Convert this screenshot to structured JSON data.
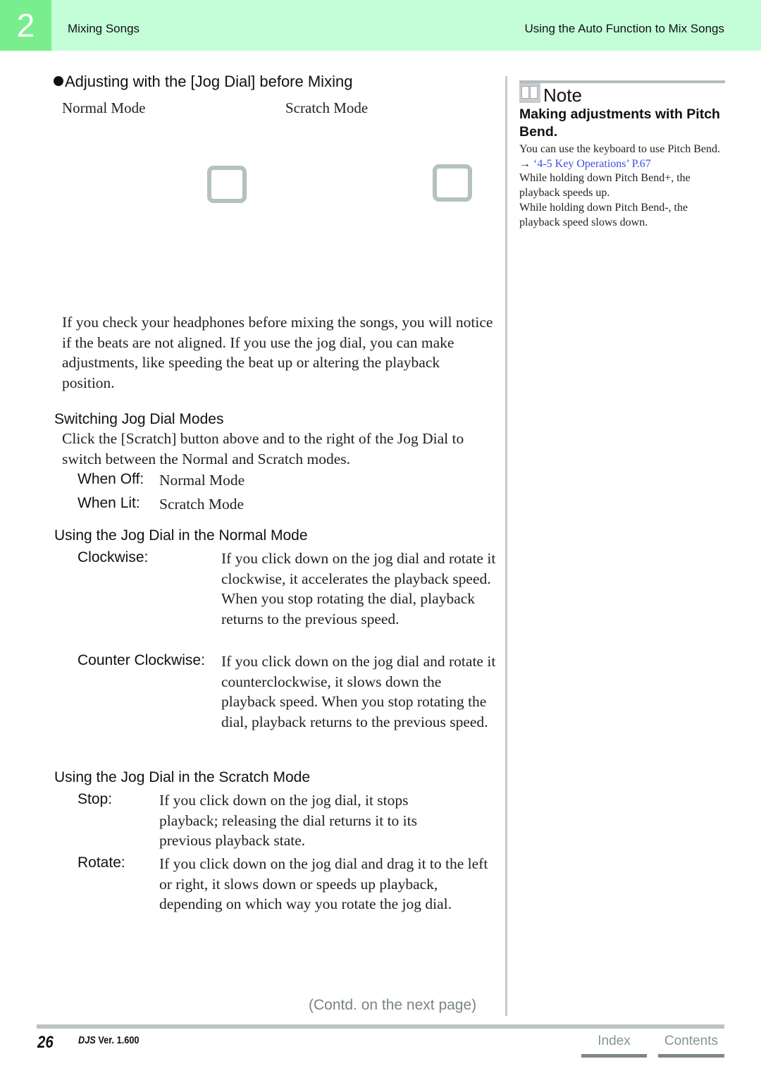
{
  "header": {
    "chapter_number": "2",
    "chapter_title": "Mixing Songs",
    "section_title": "Using the Auto Function to Mix Songs"
  },
  "main": {
    "section_heading": "Adjusting with the [Jog Dial] before Mixing",
    "bullet_icon": "filled-circle",
    "mode_labels": {
      "normal": "Normal Mode",
      "scratch": "Scratch Mode"
    },
    "intro_paragraph": "If you check your headphones before mixing the songs, you will notice if the beats are not aligned. If you use the jog dial, you can make adjustments, like speeding the beat up or altering the playback position.",
    "switching": {
      "heading": "Switching Jog Dial Modes",
      "paragraph": "Click the [Scratch] button above and to the right of the Jog Dial to switch between the Normal and Scratch modes.",
      "items": [
        {
          "term": "When Off:",
          "value": "Normal Mode"
        },
        {
          "term": "When Lit:",
          "value": "Scratch Mode"
        }
      ]
    },
    "normal_mode": {
      "heading": "Using the Jog Dial in the Normal Mode",
      "items": [
        {
          "term": "Clockwise:",
          "value": "If you click down on the jog dial and rotate it clockwise, it accelerates the playback speed. When you stop rotating the dial, playback returns to the previous speed."
        },
        {
          "term": "Counter Clockwise:",
          "value": "If you click down on the jog dial and rotate it counterclockwise, it slows down the playback speed. When you stop rotating the dial, playback returns to the previous speed."
        }
      ]
    },
    "scratch_mode": {
      "heading": "Using the Jog Dial in the Scratch Mode",
      "items": [
        {
          "term": "Stop:",
          "value": "If you click down on the jog dial, it stops playback; releasing the dial returns it to its previous playback state."
        },
        {
          "term": "Rotate:",
          "value": "If you click down on the jog dial and drag it to the left or right, it slows down or speeds up playback, depending on which way you rotate the jog dial."
        }
      ]
    },
    "continued_label": "(Contd. on the next page)"
  },
  "note": {
    "title": "Note",
    "icon": "open-book-icon",
    "heading": "Making adjustments with Pitch Bend.",
    "line1": "You can use the keyboard to use Pitch Bend.",
    "link_arrow": "→",
    "link_text": "‘4-5 Key Operations’ P.67",
    "line2": "While holding down Pitch Bend+, the playback speeds up.",
    "line3": "While holding down Pitch Bend-, the playback speed slows down.",
    "link_color": "#3b4fe0"
  },
  "footer": {
    "page_number": "26",
    "product": "DJS",
    "version": "Ver. 1.600",
    "index_label": "Index",
    "contents_label": "Contents"
  },
  "colors": {
    "header_bg": "#c4fed8",
    "chapter_box": "#7aee8e",
    "divider": "#c5cccc",
    "placeholder_border": "#b4c1c1"
  }
}
